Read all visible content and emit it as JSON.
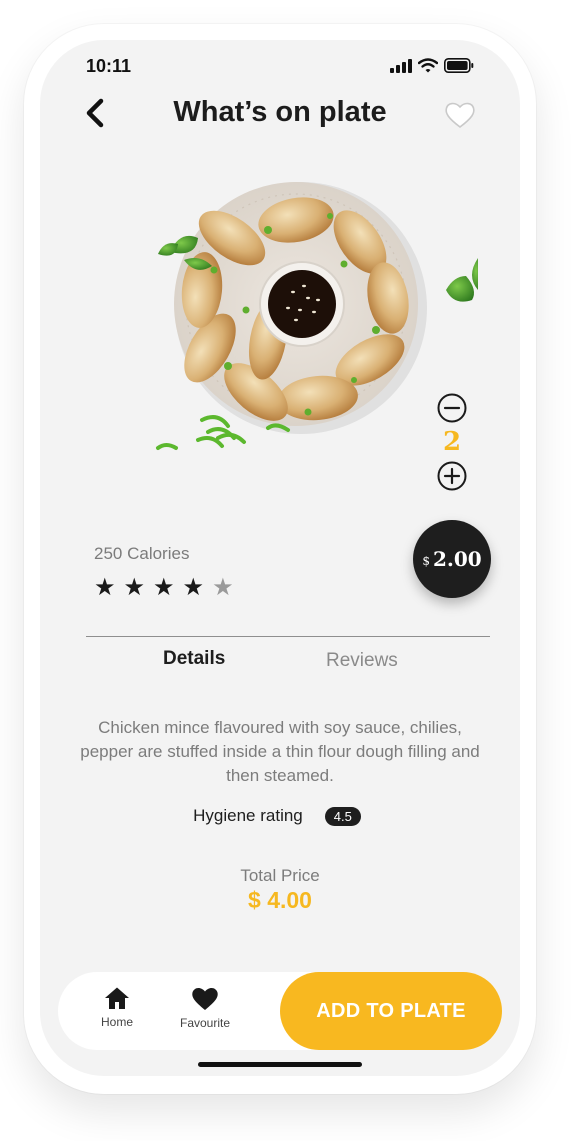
{
  "status": {
    "time": "10:11"
  },
  "header": {
    "title": "What’s on plate"
  },
  "quantity": {
    "value": "2"
  },
  "product": {
    "calories": "250 Calories",
    "rating_stars": 4,
    "rating_max": 5,
    "price_currency": "$",
    "price_amount": "2.00"
  },
  "tabs": [
    {
      "label": "Details",
      "active": true
    },
    {
      "label": "Reviews",
      "active": false
    }
  ],
  "details": {
    "description": "Chicken mince flavoured with soy sauce, chilies, pepper are stuffed inside a thin flour dough filling and then steamed.",
    "hygiene_label": "Hygiene rating",
    "hygiene_value": "4.5"
  },
  "total": {
    "label": "Total Price",
    "value": "$ 4.00"
  },
  "nav": {
    "home_label": "Home",
    "favourite_label": "Favourite",
    "add_button_label": "ADD TO PLATE"
  },
  "icons": [
    "back-arrow-icon",
    "heart-outline-icon",
    "minus-circle-icon",
    "plus-circle-icon",
    "star-icon",
    "home-icon",
    "heart-filled-icon",
    "signal-icon",
    "wifi-icon",
    "battery-icon"
  ],
  "colors": {
    "accent": "#f8b820",
    "dark": "#1e1e1e",
    "background": "#f3f3f3"
  }
}
